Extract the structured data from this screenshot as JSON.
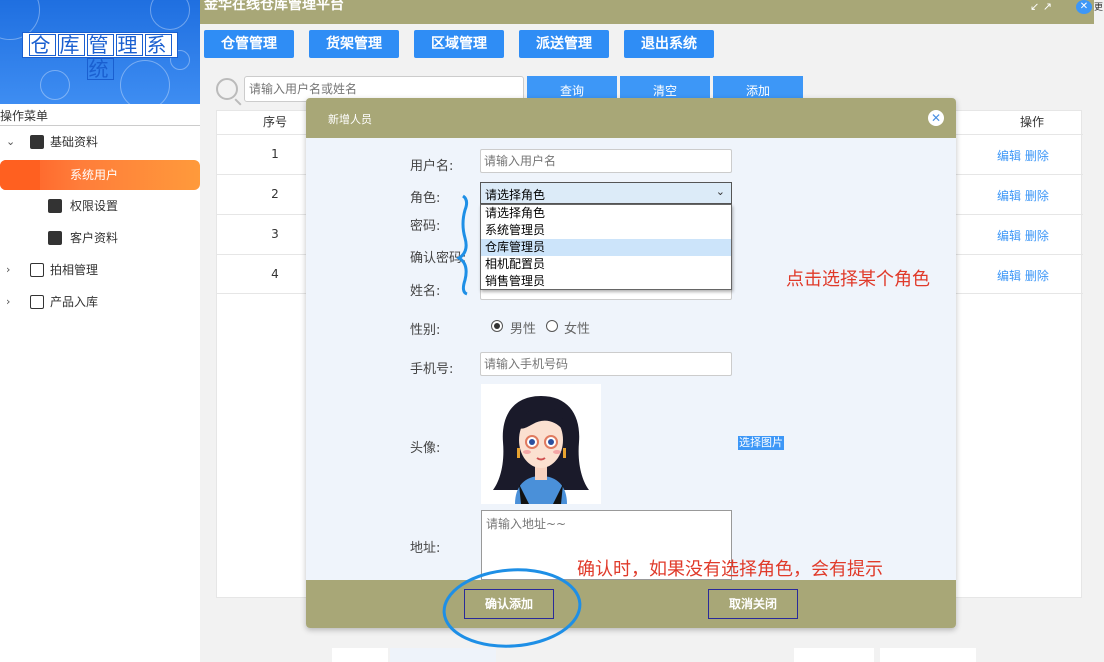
{
  "app": {
    "logo_text": [
      "仓",
      "库",
      "管",
      "理",
      "系",
      "统"
    ],
    "title": "金华在线仓库管理平台",
    "corner_text": "更"
  },
  "sidebar": {
    "header": "操作菜单",
    "items": [
      {
        "label": "基础资料",
        "expanded": true
      },
      {
        "label": "系统用户",
        "active": true
      },
      {
        "label": "权限设置"
      },
      {
        "label": "客户资料"
      },
      {
        "label": "拍相管理",
        "expanded": false
      },
      {
        "label": "产品入库"
      }
    ]
  },
  "top_nav": [
    "仓管管理",
    "货架管理",
    "区域管理",
    "派送管理",
    "退出系统"
  ],
  "search": {
    "placeholder": "请输入用户名或姓名",
    "buttons": [
      "查询",
      "清空",
      "添加"
    ]
  },
  "table": {
    "headers": {
      "index": "序号",
      "actions": "操作"
    },
    "rows": [
      "1",
      "2",
      "3",
      "4"
    ],
    "edit_label": "编辑",
    "delete_label": "删除"
  },
  "modal": {
    "title": "新增人员",
    "labels": {
      "username": "用户名:",
      "role": "角色:",
      "password": "密码:",
      "confirm_password": "确认密码:",
      "name": "姓名:",
      "gender": "性别:",
      "phone": "手机号:",
      "avatar": "头像:",
      "address": "地址:"
    },
    "username_placeholder": "请输入用户名",
    "role_selected": "请选择角色",
    "role_options": [
      "请选择角色",
      "系统管理员",
      "仓库管理员",
      "相机配置员",
      "销售管理员"
    ],
    "role_highlighted": "仓库管理员",
    "gender_options": [
      "男性",
      "女性"
    ],
    "gender_selected": "男性",
    "phone_placeholder": "请输入手机号码",
    "pick_image_label": "选择图片",
    "address_placeholder": "请输入地址~~",
    "confirm_label": "确认添加",
    "cancel_label": "取消关闭"
  },
  "annotations": {
    "select_role": "点击选择某个角色",
    "confirm_hint": "确认时，如果没有选择角色，会有提示"
  },
  "colors": {
    "accent_blue": "#2f8df5",
    "header_khaki": "#a8a777",
    "active_orange": "#ff6a2b",
    "annotation_red": "#e03a2a",
    "circle_blue": "#1e8fe6"
  }
}
